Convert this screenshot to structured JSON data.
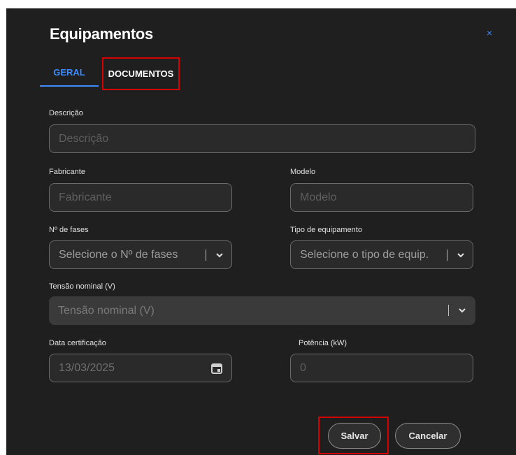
{
  "modal": {
    "title": "Equipamentos",
    "close_icon": "×"
  },
  "tabs": [
    {
      "label": "GERAL",
      "active": true
    },
    {
      "label": "DOCUMENTOS",
      "active": false
    }
  ],
  "form": {
    "descricao": {
      "label": "Descrição",
      "placeholder": "Descrição"
    },
    "fabricante": {
      "label": "Fabricante",
      "placeholder": "Fabricante"
    },
    "modelo": {
      "label": "Modelo",
      "placeholder": "Modelo"
    },
    "fases": {
      "label": "Nº de fases",
      "placeholder": "Selecione o Nº de fases"
    },
    "tipo": {
      "label": "Tipo de equipamento",
      "placeholder": "Selecione o tipo de equip."
    },
    "tensao": {
      "label": "Tensão nominal (V)",
      "placeholder": "Tensão nominal (V)"
    },
    "data_cert": {
      "label": "Data certificação",
      "value": "13/03/2025"
    },
    "potencia": {
      "label": "Potência (kW)",
      "value": "0"
    }
  },
  "actions": {
    "save_label": "Salvar",
    "cancel_label": "Cancelar"
  },
  "colors": {
    "accent": "#3d8bfd",
    "highlight": "#d50000",
    "modal_bg": "#1f1f1f"
  },
  "icons": {
    "close": "close-icon",
    "dropdown": "chevron-down-icon",
    "calendar": "calendar-icon"
  }
}
